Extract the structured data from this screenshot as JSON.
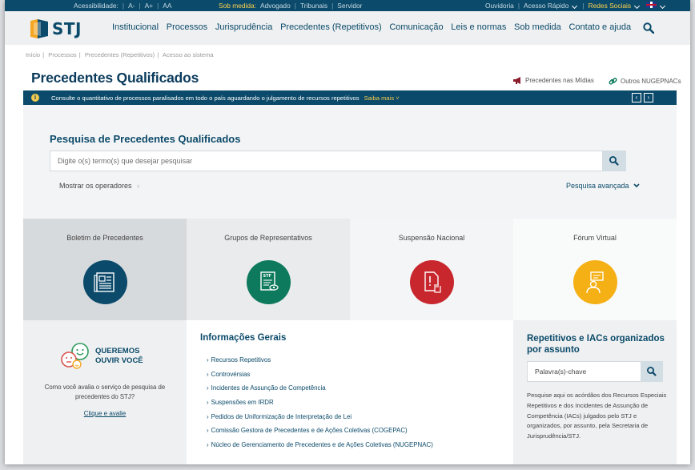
{
  "topbar": {
    "acessibilidade": "Acessibilidade:",
    "font_minus": "A-",
    "font_plus": "A+",
    "contrast": "AA",
    "sob_medida": "Sob medida:",
    "advogado": "Advogado",
    "tribunais": "Tribunais",
    "servidor": "Servidor",
    "ouvidoria": "Ouvidoria",
    "acesso_rapido": "Acesso Rápido",
    "redes_sociais": "Redes Sociais"
  },
  "logo": {
    "text": "STJ"
  },
  "menu": [
    "Institucional",
    "Processos",
    "Jurisprudência",
    "Precedentes (Repetitivos)",
    "Comunicação",
    "Leis e normas",
    "Sob medida",
    "Contato e ajuda"
  ],
  "breadcrumb": [
    "Início",
    "Processos",
    "Precedentes (Repetitivos)",
    "Acesso ao sistema"
  ],
  "page": {
    "title": "Precedentes Qualificados",
    "link_midias": "Precedentes nas Mídias",
    "link_outros": "Outros NUGEPNACs"
  },
  "notice": {
    "text": "Consulte o quantitativo de processos paralisados em todo o país aguardando o julgamento de recursos repetitivos",
    "more": "Saiba mais"
  },
  "search": {
    "title": "Pesquisa de Precedentes Qualificados",
    "placeholder": "Digite o(s) termo(s) que desejar pesquisar",
    "operators": "Mostrar os operadores",
    "advanced": "Pesquisa avançada"
  },
  "tiles": [
    {
      "label": "Boletim de Precedentes",
      "bg": "#d7dadd",
      "circle": "#0b4a6a",
      "icon": "newspaper-icon"
    },
    {
      "label": "Grupos de Representativos",
      "bg": "#e9ebec",
      "circle": "#0e7a5d",
      "icon": "stf-document-icon"
    },
    {
      "label": "Suspensão Nacional",
      "bg": "#f4f5f6",
      "circle": "#c8272d",
      "icon": "stop-hand-document-icon"
    },
    {
      "label": "Fórum Virtual",
      "bg": "#f9fafa",
      "circle": "#f5b015",
      "icon": "forum-person-icon"
    }
  ],
  "feedback": {
    "headline_1": "QUEREMOS",
    "headline_2": "OUVIR VOCÊ",
    "question": "Como você avalia o serviço de pesquisa de precedentes do STJ?",
    "link": "Clique e avalie"
  },
  "info": {
    "title": "Informações Gerais",
    "items": [
      "Recursos Repetitivos",
      "Controvérsias",
      "Incidentes de Assunção de Competência",
      "Suspensões em IRDR",
      "Pedidos de Uniformização de Interpretação de Lei",
      "Comissão Gestora de Precedentes e de Ações Coletivas (COGEPAC)",
      "Núcleo de Gerenciamento de Precedentes e de Ações Coletivas (NUGEPNAC)"
    ]
  },
  "repetitivos": {
    "title": "Repetitivos e IACs organizados por assunto",
    "placeholder": "Palavra(s)-chave",
    "description": "Pesquise aqui os acórdãos dos Recursos Especiais Repetitivos e dos Incidentes de Assunção de Competência (IACs) julgados pelo STJ e organizados, por assunto, pela Secretaria de Jurisprudência/STJ."
  },
  "colors": {
    "brand": "#0b4a6a",
    "accent": "#f2c94c"
  }
}
